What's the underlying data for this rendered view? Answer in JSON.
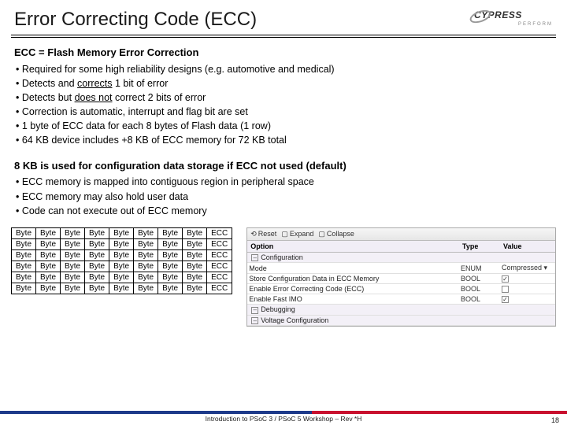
{
  "brand": {
    "name": "CYPRESS",
    "tag": "PERFORM"
  },
  "title": "Error Correcting Code (ECC)",
  "section1": {
    "heading": "ECC = Flash Memory Error Correction",
    "items": [
      "Required for some high reliability designs (e.g. automotive and medical)",
      "Detects and corrects 1 bit of error",
      "Detects but does not correct 2 bits of error",
      "Correction is automatic, interrupt and flag bit are set",
      "1 byte of ECC data for each 8 bytes of Flash data (1 row)",
      "64 KB device includes +8 KB of ECC memory for 72 KB total"
    ]
  },
  "section2": {
    "heading": "8 KB is used for configuration data storage if ECC not used (default)",
    "items": [
      "ECC memory is mapped into contiguous region in peripheral space",
      "ECC memory may also hold user data",
      "Code can not execute out of ECC memory"
    ]
  },
  "byteGrid": {
    "rows": 6,
    "cols": 8,
    "cell": "Byte",
    "tail": "ECC"
  },
  "cfg": {
    "toolbar": {
      "reset": "Reset",
      "expand": "Expand",
      "collapse": "Collapse"
    },
    "columns": {
      "option": "Option",
      "type": "Type",
      "value": "Value"
    },
    "rows": [
      {
        "kind": "group",
        "label": "Configuration"
      },
      {
        "kind": "leaf",
        "label": "Mode",
        "type": "ENUM",
        "value": "Compressed"
      },
      {
        "kind": "leaf",
        "label": "Store Configuration Data in ECC Memory",
        "type": "BOOL",
        "value": "checked"
      },
      {
        "kind": "leaf",
        "label": "Enable Error Correcting Code (ECC)",
        "type": "BOOL",
        "value": "unchecked"
      },
      {
        "kind": "leaf",
        "label": "Enable Fast IMO",
        "type": "BOOL",
        "value": "checked"
      },
      {
        "kind": "group",
        "label": "Debugging"
      },
      {
        "kind": "group",
        "label": "Voltage Configuration"
      }
    ]
  },
  "footer": {
    "text": "Introduction to PSoC 3 / PSoC 5 Workshop – Rev *H",
    "page": "18"
  }
}
